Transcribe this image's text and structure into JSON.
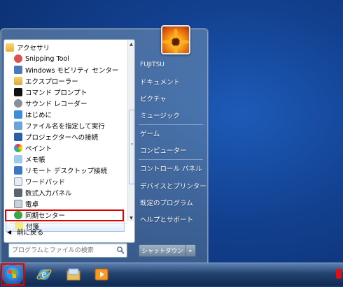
{
  "programs": {
    "folder": "アクセサリ",
    "items": [
      "Snipping Tool",
      "Windows モビリティ センター",
      "エクスプローラー",
      "コマンド プロンプト",
      "サウンド レコーダー",
      "はじめに",
      "ファイル名を指定して実行",
      "プロジェクターへの接続",
      "ペイント",
      "メモ帳",
      "リモート デスクトップ接続",
      "ワードパッド",
      "数式入力パネル",
      "電卓",
      "同期センター",
      "付箋"
    ],
    "selected": "付箋",
    "back_label": "前に戻る"
  },
  "search": {
    "placeholder": "プログラムとファイルの検索"
  },
  "right_panel": {
    "user": "FUJITSU",
    "documents": "ドキュメント",
    "pictures": "ピクチャ",
    "music": "ミュージック",
    "games": "ゲーム",
    "computer": "コンピューター",
    "control_panel": "コントロール パネル",
    "devices": "デバイスとプリンター",
    "default_programs": "既定のプログラム",
    "help": "ヘルプとサポート"
  },
  "shutdown": {
    "label": "シャットダウン",
    "arrow": "▸"
  },
  "icons": {
    "folder": "folder-icon",
    "start": "windows-orb-icon",
    "ie": "internet-explorer-icon",
    "explorer": "file-explorer-icon",
    "media": "media-player-icon"
  },
  "colors": {
    "highlight": "#e00000"
  }
}
